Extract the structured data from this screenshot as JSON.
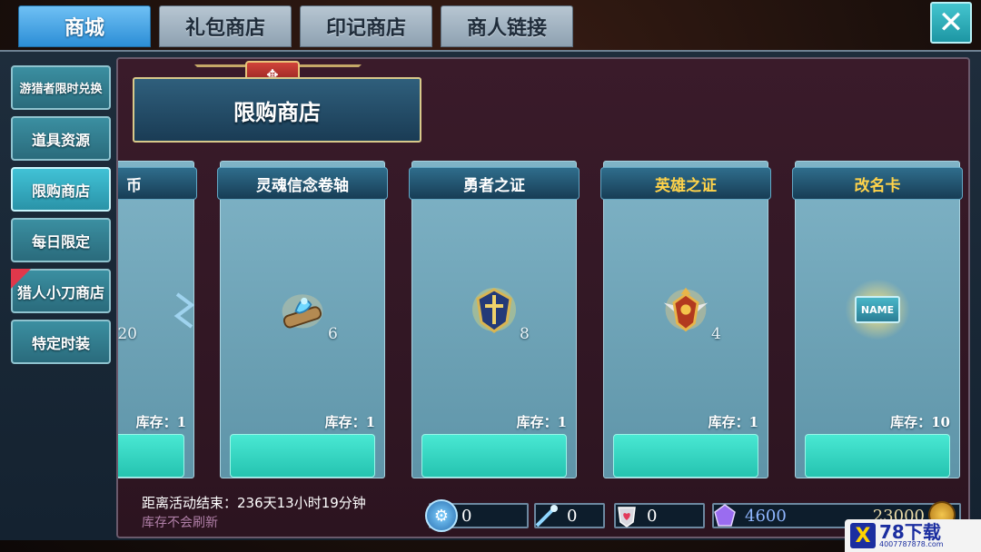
{
  "tabs": [
    {
      "label": "商城",
      "active": true
    },
    {
      "label": "礼包商店",
      "active": false
    },
    {
      "label": "印记商店",
      "active": false
    },
    {
      "label": "商人链接",
      "active": false
    }
  ],
  "close_icon": "close-icon",
  "sidebar": {
    "items": [
      {
        "label": "游猎者限时兑换"
      },
      {
        "label": "道具资源"
      },
      {
        "label": "限购商店",
        "active": true
      },
      {
        "label": "每日限定"
      },
      {
        "label": "猎人小刀商店",
        "flag": true
      },
      {
        "label": "特定时装"
      }
    ]
  },
  "panel": {
    "title": "限购商店"
  },
  "cards": [
    {
      "title": "币",
      "qty": "20",
      "stock": "库存：1",
      "icon": "partial-item-icon"
    },
    {
      "title": "灵魂信念卷轴",
      "qty": "6",
      "stock": "库存：1",
      "icon": "scroll-icon"
    },
    {
      "title": "勇者之证",
      "qty": "8",
      "stock": "库存：1",
      "icon": "shield-emblem-icon"
    },
    {
      "title": "英雄之证",
      "qty": "4",
      "stock": "库存：1",
      "icon": "winged-crest-icon",
      "gold": true
    },
    {
      "title": "改名卡",
      "qty": "",
      "stock": "库存：10",
      "icon": "name-card-icon",
      "art_text": "NAME"
    }
  ],
  "footer": {
    "countdown": "距离活动结束：236天13小时19分钟",
    "note": "库存不会刷新",
    "currencies": [
      {
        "icon": "gear-coin-icon",
        "value": "0"
      },
      {
        "icon": "wand-icon",
        "value": "0"
      },
      {
        "icon": "heart-badge-icon",
        "value": "0"
      },
      {
        "icon": "gem-icon",
        "value": "4600"
      },
      {
        "icon": "gold-coin-icon",
        "value": "23000"
      }
    ]
  },
  "watermark": {
    "logo": "X",
    "brand": "78下载",
    "url": "4007787878.com"
  }
}
